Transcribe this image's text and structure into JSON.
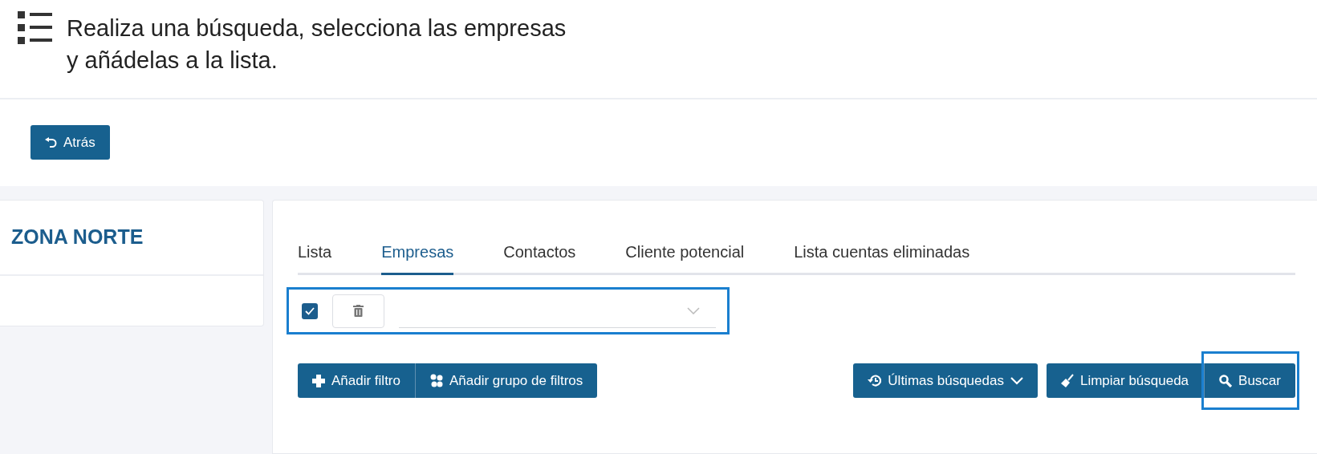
{
  "header": {
    "title": "Realiza una búsqueda, selecciona las empresas\ny añádelas a la lista."
  },
  "back_button": {
    "label": "Atrás"
  },
  "sidebar": {
    "title": "ZONA NORTE"
  },
  "tabs": [
    {
      "label": "Lista",
      "selected": false
    },
    {
      "label": "Empresas",
      "selected": true
    },
    {
      "label": "Contactos",
      "selected": false
    },
    {
      "label": "Cliente potencial",
      "selected": false
    },
    {
      "label": "Lista cuentas eliminadas",
      "selected": false
    }
  ],
  "filter_row": {
    "checked": true,
    "highlighted": true
  },
  "filter_buttons": [
    {
      "kind": "add",
      "label": "Añadir filtro"
    },
    {
      "kind": "group",
      "label": "Añadir grupo de filtros"
    }
  ],
  "search_buttons": [
    {
      "kind": "history",
      "label": "Últimas búsquedas",
      "highlighted": false
    },
    {
      "kind": "clear",
      "label": "Limpiar búsqueda",
      "highlighted": false
    },
    {
      "kind": "search",
      "label": "Buscar",
      "highlighted": true
    }
  ]
}
